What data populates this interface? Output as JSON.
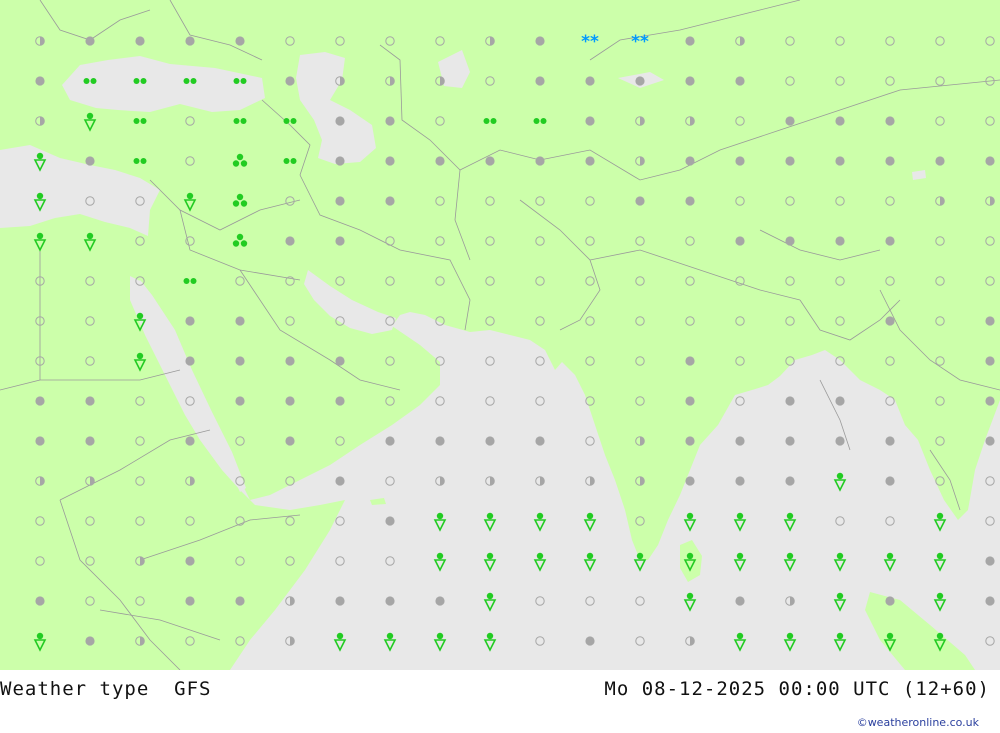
{
  "footer": {
    "title": "Weather type",
    "model": "GFS",
    "datetime": "Mo 08-12-2025 00:00 UTC (12+60)",
    "credit": "©weatheronline.co.uk"
  },
  "colors": {
    "land": "#ccffaa",
    "sea": "#e8e8e8",
    "borders": "#9a9a9a",
    "rain_symbol": "#22cc22",
    "snow_symbol": "#0099ff",
    "cloud_dot": "#a6a6a6"
  },
  "map": {
    "symbol_types": {
      "O": "clear-ring-icon",
      "H": "partly-cloudy-icon",
      "F": "overcast-dot-icon",
      "D": "light-rain-drops-icon",
      "T": "rain-drops-icon",
      "S": "shower-icon",
      "W": "snow-icon"
    },
    "grid": [
      "HFFFFOOOOHFWWFHOOOOO",
      "FDDDDFHHHOFFFFFOOOOO",
      "HSDODDFFODDFHHOFFFOO",
      "SFDOTDFFFFFFHFFFFFFF",
      "SOOSTOFFOOOOFFOOOOHH",
      "SSOOTFFOOOOOOOFFFFOO",
      "OOODOOOOOOOOOOOOOOOO",
      "OOSFFOOOOOOOOOOOOFOF",
      "OOSFFFFOOOOOOFOOOOOF",
      "FFOOFFFOOOOOOFOFFOOF",
      "FFOFOFOFFFFOHFFFFFOF",
      "HHOHOOFOHHHHHFFFSFOO",
      "OOOOOOOFSSSSOSSSOOSO",
      "OOHFOOOOSSSSSSSSSSSF",
      "FOOFFHFFFSOOOSFHSFSF",
      "SFHOOHSSSSOFOHSSSSSO"
    ]
  }
}
